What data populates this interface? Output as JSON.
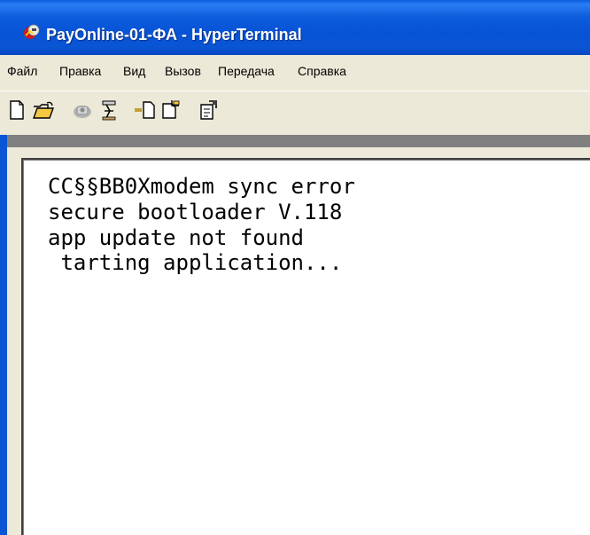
{
  "window": {
    "title": "PayOnline-01-ФА - HyperTerminal",
    "title_icon": "hyperterminal-app-icon"
  },
  "menu": {
    "items": [
      "Файл",
      "Правка",
      "Вид",
      "Вызов",
      "Передача",
      "Справка"
    ]
  },
  "toolbar": {
    "buttons": [
      {
        "icon": "new-document-icon"
      },
      {
        "icon": "open-folder-icon"
      },
      {
        "icon": "connect-phone-icon"
      },
      {
        "icon": "disconnect-phone-icon"
      },
      {
        "icon": "send-file-icon"
      },
      {
        "icon": "receive-file-icon"
      },
      {
        "icon": "properties-icon"
      }
    ]
  },
  "terminal": {
    "lines": [
      "CC§§BB0Xmodem sync error",
      "secure bootloader V.118",
      "app update not found",
      " tarting application..."
    ]
  },
  "colors": {
    "titlebar": "#0a55d4",
    "chrome": "#ece9d8",
    "terminal_bg": "#ffffff",
    "terminal_text": "#000000"
  }
}
